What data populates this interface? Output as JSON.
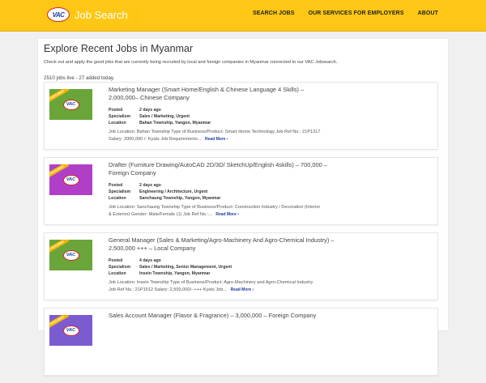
{
  "header": {
    "logo_text": "VAC",
    "title": "Job Search",
    "nav": [
      "SEARCH JOBS",
      "OUR SERVICES FOR EMPLOYERS",
      "ABOUT"
    ]
  },
  "page": {
    "title": "Explore Recent Jobs in Myanmar",
    "intro": "Check out and apply the good jobs that are currently being recruited by local and foreign companies in Myanmar connected to our VAC Jobsearch.",
    "count": "2510 jobs live - 27 added today."
  },
  "labels": {
    "posted": "Posted",
    "specialism": "Specialism",
    "location": "Location",
    "read_more": "Read More ›",
    "featured": "FEATURED"
  },
  "colors": {
    "header": "#fec715",
    "link": "#1f3f9c"
  },
  "jobs": [
    {
      "title": "Marketing Manager (Smart Home/English & Chinese Language 4 Skills) – 2,000,000– Chinese Company",
      "posted": "2 days ago",
      "specialism": "Sales / Marketing, Urgent",
      "location": "Bahan Township, Yangon, Myanmar",
      "desc": "Job Location: Bahan Township Type of Business/Product: Smart Home Technology Job Ref No.: 21P1317 Salary: 2000,000 /- Kyats Job Requirements...",
      "thumb_color": "#6aa53a"
    },
    {
      "title": "Drafter (Furniture Drawing/AutoCAD 2D/3D/ SketchUp/English 4skills) – 700,000 – Foreign Company",
      "posted": "2 days ago",
      "specialism": "Engineering / Architecture, Urgent",
      "location": "Sanchaung Township, Yangon, Myanmar",
      "desc": "Job Location: Sanchaung Township Type of Business/Product: Construction Industry / Decoration (Interior & Exterior) Gender: Male/Female (1) Job Ref No.:...",
      "thumb_color": "#b03fc8"
    },
    {
      "title": "General Manager (Sales & Marketing/Agro-Machinery And Agro-Chemical Industry) – 2,500,000 +++ – Local Company",
      "posted": "4 days ago",
      "specialism": "Sales / Marketing, Senior Management, Urgent",
      "location": "Insein Township, Yangon, Myanmar",
      "desc": "Job Location: Insein Township Type of Business/Product: Agro-Machinery and Agro-Chemical Industry Job Ref No.: 21P1512 Salary: 2,500,000/- +++ Kyats Job...",
      "thumb_color": "#6aa53a"
    },
    {
      "title": "Sales Account Manager (Flavor & Fragrance) – 3,000,000 – Foreign Company",
      "posted": "",
      "specialism": "",
      "location": "",
      "desc": "",
      "thumb_color": "#7b5bd0"
    }
  ]
}
